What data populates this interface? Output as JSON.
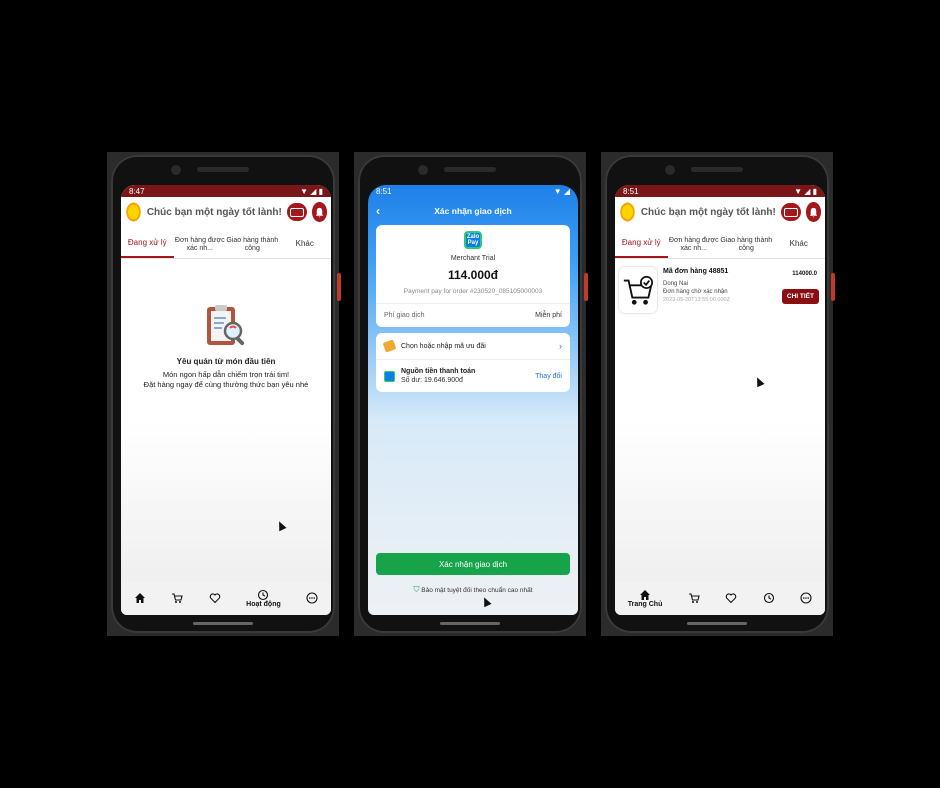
{
  "phone1": {
    "time": "8:47",
    "greeting": "Chúc bạn một ngày tốt lành!",
    "tabs": [
      "Đang xử lý",
      "Đơn hàng được xác nh...",
      "Giao hàng thành công",
      "Khác"
    ],
    "empty_title": "Yêu quán từ món đầu tiên",
    "empty_desc_1": "Món ngon hấp dẫn chiếm trọn trái tim!",
    "empty_desc_2": "Đặt hàng ngay để cùng thưởng thức bạn yêu nhé",
    "nav_active_label": "Hoạt động"
  },
  "phone2": {
    "time": "8:51",
    "title": "Xác nhận giao dịch",
    "logo_text": "Zalo Pay",
    "merchant": "Merchant Trial",
    "amount": "114.000đ",
    "order_ref": "Payment pay for order #230520_085105000003",
    "fee_label": "Phí giao dịch",
    "fee_value": "Miễn phí",
    "promo_label": "Chọn hoặc nhập mã ưu đãi",
    "source_title": "Nguồn tiền thanh toán",
    "source_balance": "Số dư: 19.646.900đ",
    "change_label": "Thay đổi",
    "confirm_label": "Xác nhận giao dịch",
    "secure_text": "Bảo mật tuyệt đối theo chuẩn cao nhất"
  },
  "phone3": {
    "time": "8:51",
    "greeting": "Chúc bạn một ngày tốt lành!",
    "tabs": [
      "Đang xử lý",
      "Đơn hàng được xác nh...",
      "Giao hàng thành công",
      "Khác"
    ],
    "order": {
      "code": "Mã đơn hàng 48851",
      "price": "114000.0",
      "location": "Dong Nai",
      "status": "Đơn hàng chờ xác nhận",
      "date": "2023-05-20T13:55:00.000Z",
      "detail_label": "CHI TIẾT"
    },
    "nav_active_label": "Trang Chủ"
  },
  "colors": {
    "brand": "#a3181c",
    "status_bar": "#7a1618",
    "pay_blue": "#1e7fe8",
    "confirm_green": "#16a34a"
  }
}
